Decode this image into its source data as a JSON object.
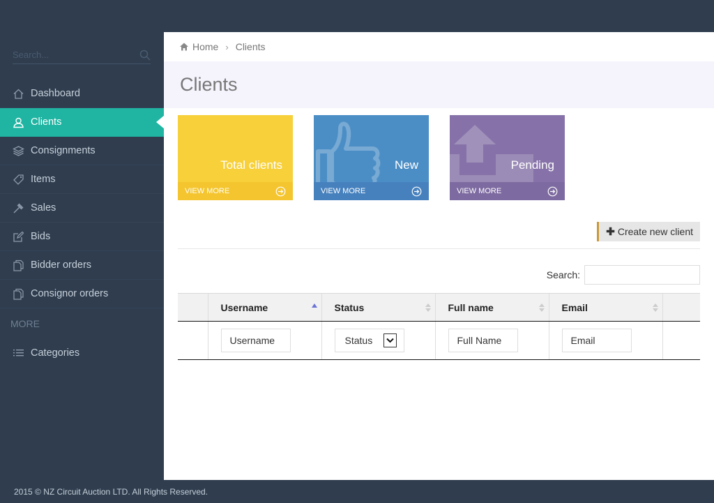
{
  "sidebar": {
    "search_placeholder": "Search...",
    "items": [
      {
        "label": "Dashboard",
        "icon": "home-icon"
      },
      {
        "label": "Clients",
        "icon": "users-icon",
        "active": true
      },
      {
        "label": "Consignments",
        "icon": "layers-icon"
      },
      {
        "label": "Items",
        "icon": "tag-icon"
      },
      {
        "label": "Sales",
        "icon": "gavel-icon"
      },
      {
        "label": "Bids",
        "icon": "edit-icon"
      },
      {
        "label": "Bidder orders",
        "icon": "copy-icon"
      },
      {
        "label": "Consignor orders",
        "icon": "copy-icon"
      }
    ],
    "section_more": "MORE",
    "more_items": [
      {
        "label": "Categories",
        "icon": "list-icon"
      }
    ]
  },
  "breadcrumb": {
    "home": "Home",
    "current": "Clients"
  },
  "page": {
    "title": "Clients"
  },
  "tiles": [
    {
      "label": "Total clients",
      "footer": "VIEW MORE",
      "color": "#f7d03a",
      "foot_color": "#f4c52e"
    },
    {
      "label": "New",
      "footer": "VIEW MORE",
      "color": "#4b8ec6",
      "foot_color": "#4681be",
      "icon": "thumbs-up-icon"
    },
    {
      "label": "Pending",
      "footer": "VIEW MORE",
      "color": "#8672a8",
      "foot_color": "#7d6aa0",
      "icon": "upload-icon"
    }
  ],
  "actions": {
    "create_label": "Create new client"
  },
  "table": {
    "search_label": "Search:",
    "columns": [
      "Username",
      "Status",
      "Full name",
      "Email"
    ],
    "filters": {
      "username": "Username",
      "status": "Status",
      "full_name": "Full Name",
      "email": "Email"
    }
  },
  "footer": {
    "text": "2015 © NZ Circuit Auction LTD. All Rights Reserved."
  }
}
